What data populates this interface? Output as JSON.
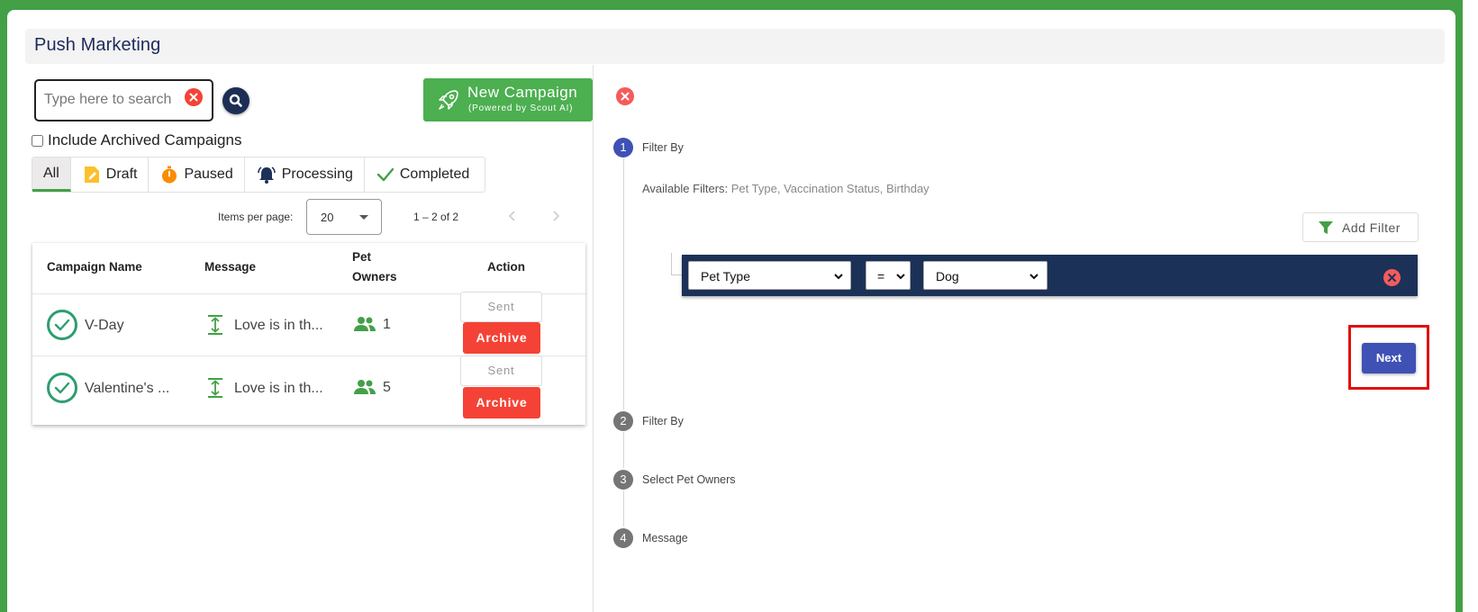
{
  "page": {
    "title": "Push Marketing"
  },
  "search": {
    "placeholder": "Type here to search",
    "value": ""
  },
  "new_campaign": {
    "label": "New Campaign",
    "sublabel": "(Powered by Scout AI)"
  },
  "archived_toggle": {
    "label": "Include Archived Campaigns",
    "checked": false
  },
  "tabs": [
    {
      "label": "All",
      "active": true,
      "icon": ""
    },
    {
      "label": "Draft",
      "active": false,
      "icon": "draft-tag-icon"
    },
    {
      "label": "Paused",
      "active": false,
      "icon": "stopwatch-icon"
    },
    {
      "label": "Processing",
      "active": false,
      "icon": "bell-ringing-icon"
    },
    {
      "label": "Completed",
      "active": false,
      "icon": "check-icon"
    }
  ],
  "pagination": {
    "items_per_page_label": "Items per page:",
    "items_per_page": "20",
    "range_label": "1 – 2 of 2"
  },
  "table": {
    "headers": {
      "name": "Campaign Name",
      "message": "Message",
      "owners_line1": "Pet",
      "owners_line2": "Owners",
      "action": "Action"
    },
    "rows": [
      {
        "name": "V-Day",
        "message": "Love is in th...",
        "owners": "1",
        "status": "Sent",
        "archive": "Archive"
      },
      {
        "name": "Valentine's ...",
        "message": "Love is in th...",
        "owners": "5",
        "status": "Sent",
        "archive": "Archive"
      }
    ]
  },
  "stepper": {
    "steps": [
      {
        "num": "1",
        "label": "Filter By",
        "active": true
      },
      {
        "num": "2",
        "label": "Filter By",
        "active": false
      },
      {
        "num": "3",
        "label": "Select Pet Owners",
        "active": false
      },
      {
        "num": "4",
        "label": "Message",
        "active": false
      }
    ],
    "available_label": "Available Filters:",
    "available_values": "Pet Type, Vaccination Status, Birthday",
    "add_filter": "Add Filter",
    "filter": {
      "field": "Pet Type",
      "operator": "=",
      "value": "Dog"
    },
    "next": "Next"
  },
  "colors": {
    "accent_green": "#43a047",
    "navy": "#1c3157",
    "primary": "#3f51b5",
    "danger": "#f44336",
    "highlight": "#e01010"
  }
}
